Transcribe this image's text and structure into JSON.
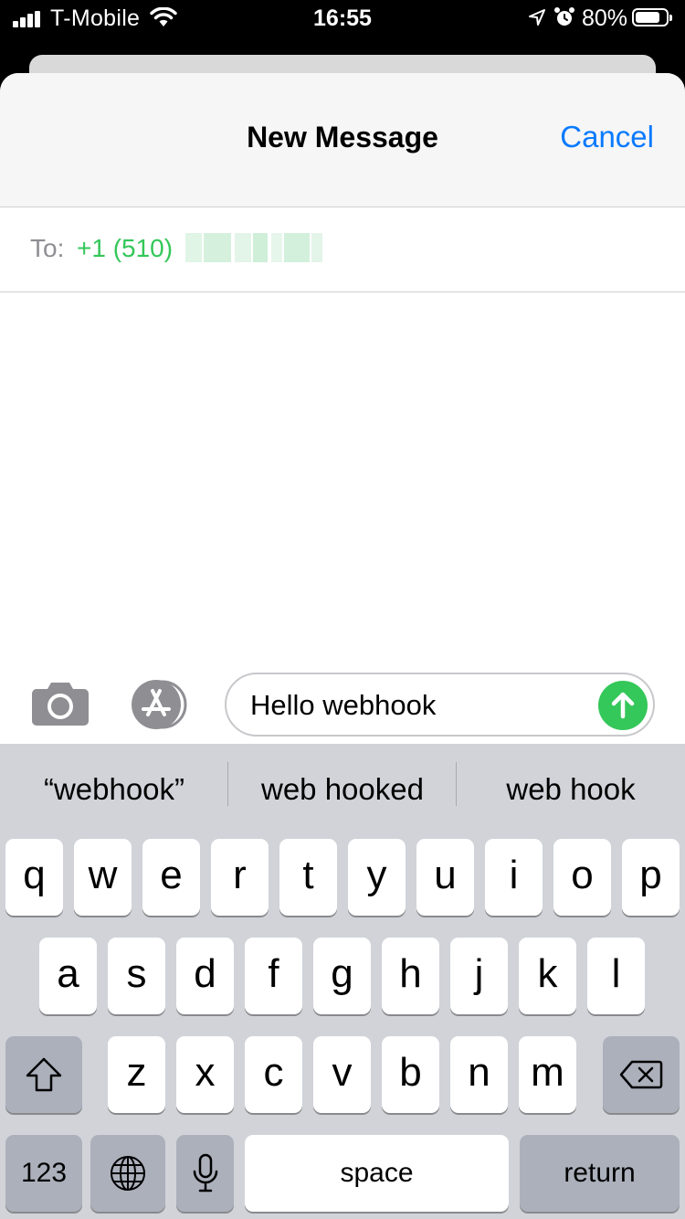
{
  "status_bar": {
    "carrier": "T-Mobile",
    "time": "16:55",
    "battery_percent": "80%",
    "battery_level": 0.8,
    "icons": [
      "signal-icon",
      "wifi-icon",
      "location-icon",
      "alarm-icon",
      "battery-icon"
    ]
  },
  "header": {
    "title": "New Message",
    "cancel_label": "Cancel"
  },
  "recipient": {
    "label": "To:",
    "number": "+1 (510)"
  },
  "compose": {
    "message_text": "Hello webhook",
    "icons": [
      "camera-icon",
      "app-store-icon",
      "send-arrow-icon"
    ]
  },
  "keyboard": {
    "suggestions": [
      "“webhook”",
      "web hooked",
      "web hook"
    ],
    "row1": [
      "q",
      "w",
      "e",
      "r",
      "t",
      "y",
      "u",
      "i",
      "o",
      "p"
    ],
    "row2": [
      "a",
      "s",
      "d",
      "f",
      "g",
      "h",
      "j",
      "k",
      "l"
    ],
    "row3": [
      "z",
      "x",
      "c",
      "v",
      "b",
      "n",
      "m"
    ],
    "numbers_label": "123",
    "space_label": "space",
    "return_label": "return",
    "icons": [
      "shift-icon",
      "backspace-icon",
      "globe-icon",
      "microphone-icon"
    ]
  },
  "colors": {
    "accent_blue": "#0a7aff",
    "imessage_green": "#34c759",
    "keyboard_bg": "#d1d3d9"
  }
}
